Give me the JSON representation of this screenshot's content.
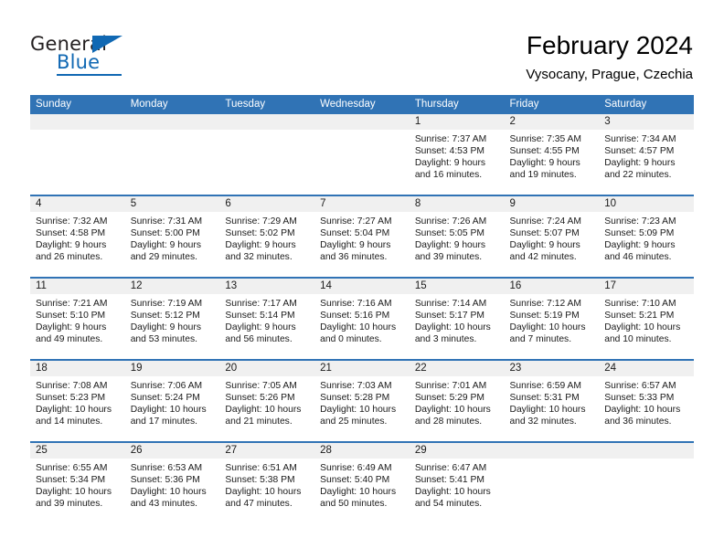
{
  "brand": {
    "name_part1": "General",
    "name_part2": "Blue",
    "triangle_color": "#1068b3",
    "text_color": "#231f20"
  },
  "header": {
    "title": "February 2024",
    "subtitle": "Vysocany, Prague, Czechia"
  },
  "theme": {
    "header_blue": "#3073b5",
    "day_band_gray": "#f0f0f0",
    "text_color": "#1a1a1a"
  },
  "calendar": {
    "weekdays": [
      "Sunday",
      "Monday",
      "Tuesday",
      "Wednesday",
      "Thursday",
      "Friday",
      "Saturday"
    ],
    "weeks": [
      [
        {
          "day": "",
          "lines": []
        },
        {
          "day": "",
          "lines": []
        },
        {
          "day": "",
          "lines": []
        },
        {
          "day": "",
          "lines": []
        },
        {
          "day": "1",
          "lines": [
            "Sunrise: 7:37 AM",
            "Sunset: 4:53 PM",
            "Daylight: 9 hours",
            "and 16 minutes."
          ]
        },
        {
          "day": "2",
          "lines": [
            "Sunrise: 7:35 AM",
            "Sunset: 4:55 PM",
            "Daylight: 9 hours",
            "and 19 minutes."
          ]
        },
        {
          "day": "3",
          "lines": [
            "Sunrise: 7:34 AM",
            "Sunset: 4:57 PM",
            "Daylight: 9 hours",
            "and 22 minutes."
          ]
        }
      ],
      [
        {
          "day": "4",
          "lines": [
            "Sunrise: 7:32 AM",
            "Sunset: 4:58 PM",
            "Daylight: 9 hours",
            "and 26 minutes."
          ]
        },
        {
          "day": "5",
          "lines": [
            "Sunrise: 7:31 AM",
            "Sunset: 5:00 PM",
            "Daylight: 9 hours",
            "and 29 minutes."
          ]
        },
        {
          "day": "6",
          "lines": [
            "Sunrise: 7:29 AM",
            "Sunset: 5:02 PM",
            "Daylight: 9 hours",
            "and 32 minutes."
          ]
        },
        {
          "day": "7",
          "lines": [
            "Sunrise: 7:27 AM",
            "Sunset: 5:04 PM",
            "Daylight: 9 hours",
            "and 36 minutes."
          ]
        },
        {
          "day": "8",
          "lines": [
            "Sunrise: 7:26 AM",
            "Sunset: 5:05 PM",
            "Daylight: 9 hours",
            "and 39 minutes."
          ]
        },
        {
          "day": "9",
          "lines": [
            "Sunrise: 7:24 AM",
            "Sunset: 5:07 PM",
            "Daylight: 9 hours",
            "and 42 minutes."
          ]
        },
        {
          "day": "10",
          "lines": [
            "Sunrise: 7:23 AM",
            "Sunset: 5:09 PM",
            "Daylight: 9 hours",
            "and 46 minutes."
          ]
        }
      ],
      [
        {
          "day": "11",
          "lines": [
            "Sunrise: 7:21 AM",
            "Sunset: 5:10 PM",
            "Daylight: 9 hours",
            "and 49 minutes."
          ]
        },
        {
          "day": "12",
          "lines": [
            "Sunrise: 7:19 AM",
            "Sunset: 5:12 PM",
            "Daylight: 9 hours",
            "and 53 minutes."
          ]
        },
        {
          "day": "13",
          "lines": [
            "Sunrise: 7:17 AM",
            "Sunset: 5:14 PM",
            "Daylight: 9 hours",
            "and 56 minutes."
          ]
        },
        {
          "day": "14",
          "lines": [
            "Sunrise: 7:16 AM",
            "Sunset: 5:16 PM",
            "Daylight: 10 hours",
            "and 0 minutes."
          ]
        },
        {
          "day": "15",
          "lines": [
            "Sunrise: 7:14 AM",
            "Sunset: 5:17 PM",
            "Daylight: 10 hours",
            "and 3 minutes."
          ]
        },
        {
          "day": "16",
          "lines": [
            "Sunrise: 7:12 AM",
            "Sunset: 5:19 PM",
            "Daylight: 10 hours",
            "and 7 minutes."
          ]
        },
        {
          "day": "17",
          "lines": [
            "Sunrise: 7:10 AM",
            "Sunset: 5:21 PM",
            "Daylight: 10 hours",
            "and 10 minutes."
          ]
        }
      ],
      [
        {
          "day": "18",
          "lines": [
            "Sunrise: 7:08 AM",
            "Sunset: 5:23 PM",
            "Daylight: 10 hours",
            "and 14 minutes."
          ]
        },
        {
          "day": "19",
          "lines": [
            "Sunrise: 7:06 AM",
            "Sunset: 5:24 PM",
            "Daylight: 10 hours",
            "and 17 minutes."
          ]
        },
        {
          "day": "20",
          "lines": [
            "Sunrise: 7:05 AM",
            "Sunset: 5:26 PM",
            "Daylight: 10 hours",
            "and 21 minutes."
          ]
        },
        {
          "day": "21",
          "lines": [
            "Sunrise: 7:03 AM",
            "Sunset: 5:28 PM",
            "Daylight: 10 hours",
            "and 25 minutes."
          ]
        },
        {
          "day": "22",
          "lines": [
            "Sunrise: 7:01 AM",
            "Sunset: 5:29 PM",
            "Daylight: 10 hours",
            "and 28 minutes."
          ]
        },
        {
          "day": "23",
          "lines": [
            "Sunrise: 6:59 AM",
            "Sunset: 5:31 PM",
            "Daylight: 10 hours",
            "and 32 minutes."
          ]
        },
        {
          "day": "24",
          "lines": [
            "Sunrise: 6:57 AM",
            "Sunset: 5:33 PM",
            "Daylight: 10 hours",
            "and 36 minutes."
          ]
        }
      ],
      [
        {
          "day": "25",
          "lines": [
            "Sunrise: 6:55 AM",
            "Sunset: 5:34 PM",
            "Daylight: 10 hours",
            "and 39 minutes."
          ]
        },
        {
          "day": "26",
          "lines": [
            "Sunrise: 6:53 AM",
            "Sunset: 5:36 PM",
            "Daylight: 10 hours",
            "and 43 minutes."
          ]
        },
        {
          "day": "27",
          "lines": [
            "Sunrise: 6:51 AM",
            "Sunset: 5:38 PM",
            "Daylight: 10 hours",
            "and 47 minutes."
          ]
        },
        {
          "day": "28",
          "lines": [
            "Sunrise: 6:49 AM",
            "Sunset: 5:40 PM",
            "Daylight: 10 hours",
            "and 50 minutes."
          ]
        },
        {
          "day": "29",
          "lines": [
            "Sunrise: 6:47 AM",
            "Sunset: 5:41 PM",
            "Daylight: 10 hours",
            "and 54 minutes."
          ]
        },
        {
          "day": "",
          "lines": []
        },
        {
          "day": "",
          "lines": []
        }
      ]
    ]
  }
}
